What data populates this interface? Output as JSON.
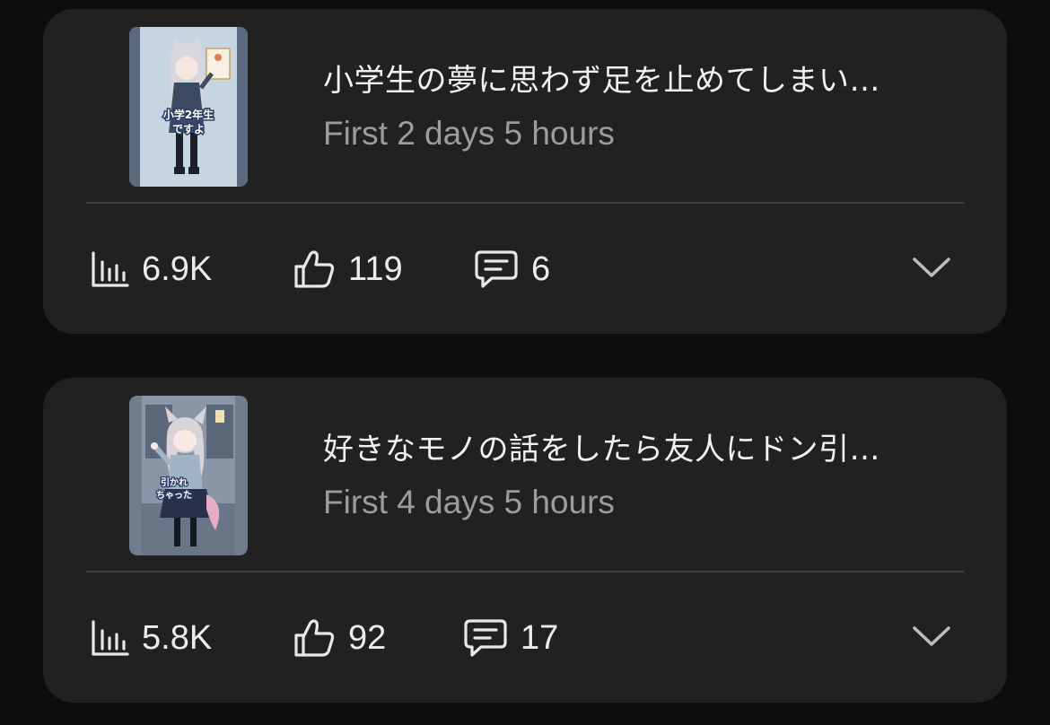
{
  "colors": {
    "background": "#0d0d0d",
    "card": "#212121",
    "title_text": "#f1f1f1",
    "meta_text": "#9c9c9c",
    "divider": "#3e3e3e",
    "icon": "#e8e8e8"
  },
  "posts": [
    {
      "title": "小学生の夢に思わず足を止めてしまい…",
      "meta": "First 2 days 5 hours",
      "thumbnail_caption": "小学2年生ですよ",
      "stats": {
        "views": "6.9K",
        "likes": "119",
        "comments": "6"
      },
      "icons": [
        "bar-chart-icon",
        "thumbs-up-icon",
        "comment-icon",
        "chevron-down-icon"
      ]
    },
    {
      "title": "好きなモノの話をしたら友人にドン引…",
      "meta": "First 4 days 5 hours",
      "thumbnail_caption": "引かれちゃった…",
      "stats": {
        "views": "5.8K",
        "likes": "92",
        "comments": "17"
      },
      "icons": [
        "bar-chart-icon",
        "thumbs-up-icon",
        "comment-icon",
        "chevron-down-icon"
      ]
    }
  ]
}
